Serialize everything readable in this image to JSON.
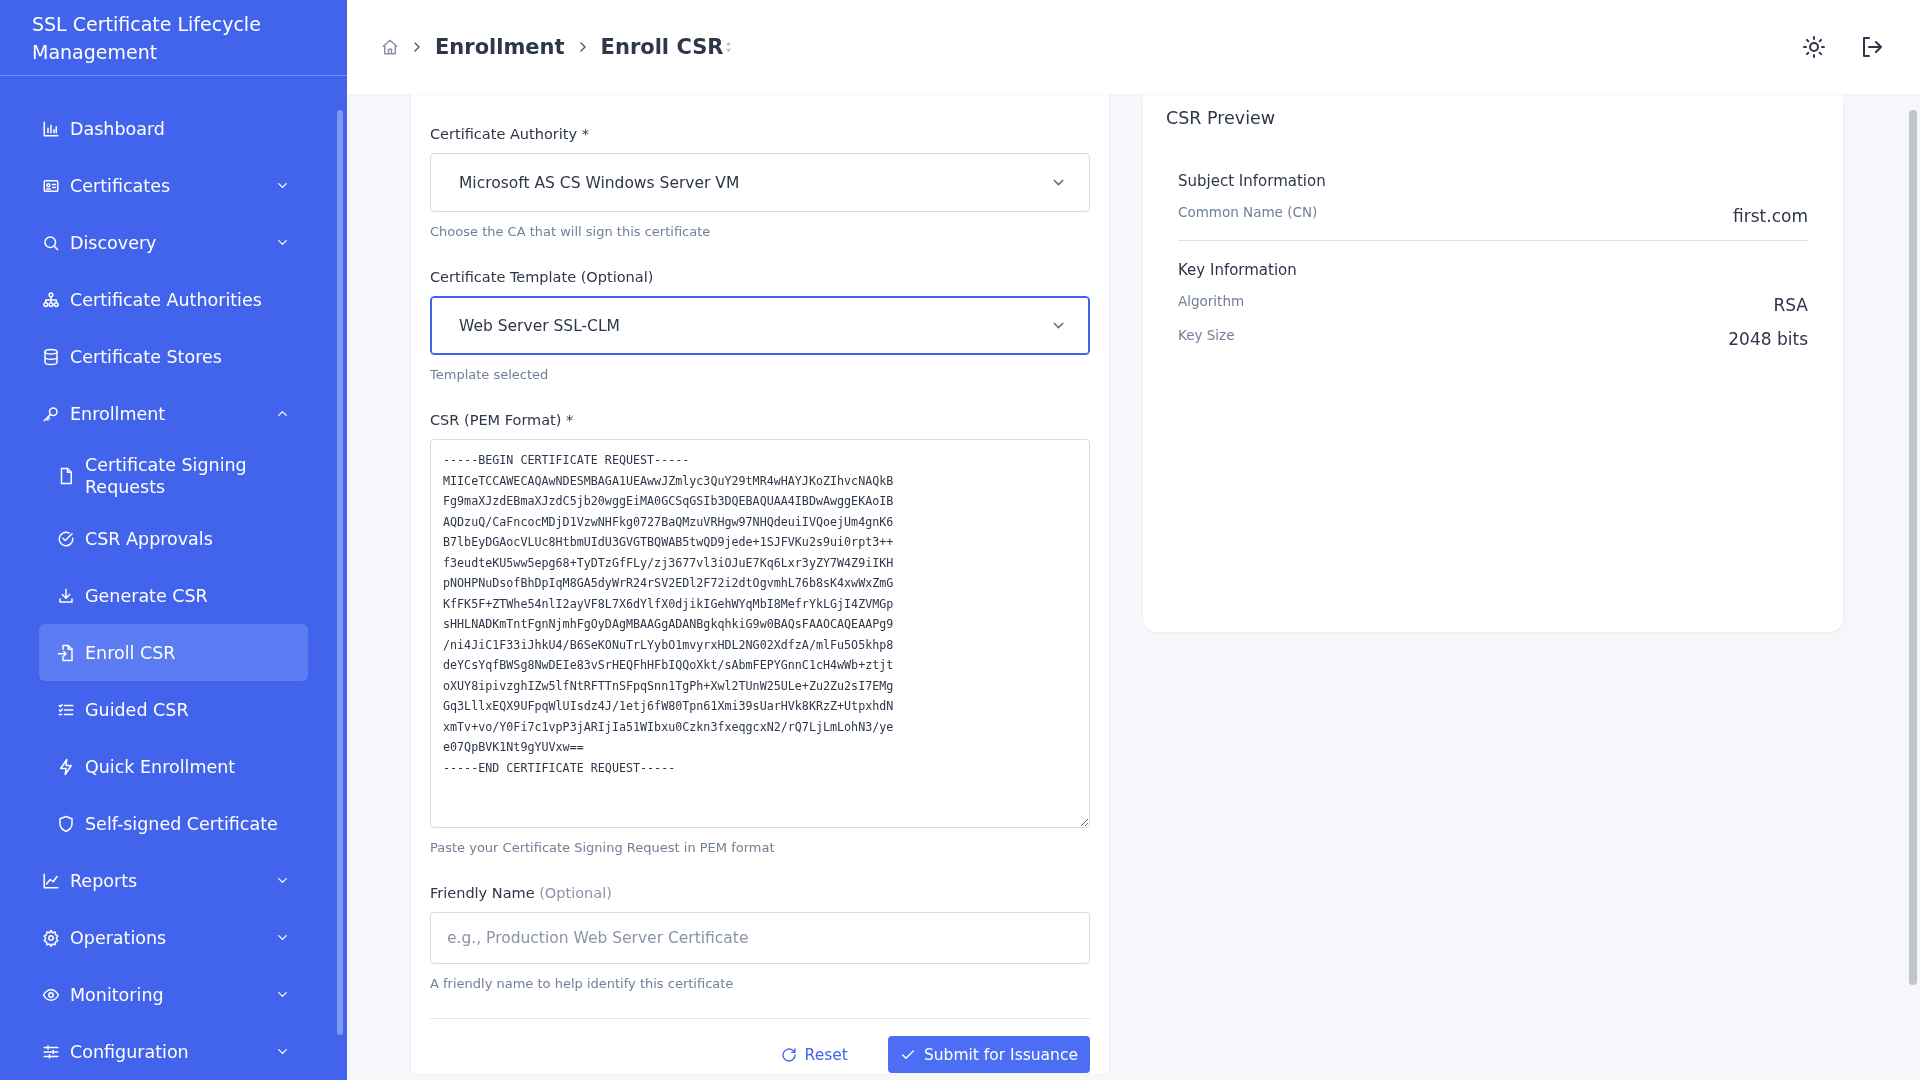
{
  "sidebar": {
    "title": "SSL Certificate Lifecycle Management",
    "items": [
      {
        "label": "Dashboard",
        "selected": false
      },
      {
        "label": "Certificates",
        "selected": false,
        "expanded": false
      },
      {
        "label": "Discovery",
        "selected": false,
        "expanded": false
      },
      {
        "label": "Certificate Authorities",
        "selected": false
      },
      {
        "label": "Certificate Stores",
        "selected": false
      },
      {
        "label": "Enrollment",
        "selected": false,
        "expanded": true,
        "children": [
          {
            "label": "Certificate Signing Requests",
            "selected": false
          },
          {
            "label": "CSR Approvals",
            "selected": false
          },
          {
            "label": "Generate CSR",
            "selected": false
          },
          {
            "label": "Enroll CSR",
            "selected": true
          },
          {
            "label": "Guided CSR",
            "selected": false
          },
          {
            "label": "Quick Enrollment",
            "selected": false
          },
          {
            "label": "Self-signed Certificate",
            "selected": false
          }
        ]
      },
      {
        "label": "Reports",
        "selected": false,
        "expanded": false
      },
      {
        "label": "Operations",
        "selected": false,
        "expanded": false
      },
      {
        "label": "Monitoring",
        "selected": false,
        "expanded": false
      },
      {
        "label": "Configuration",
        "selected": false,
        "expanded": false
      }
    ]
  },
  "breadcrumb": [
    "Enrollment",
    "Enroll CSR"
  ],
  "form": {
    "fields": [
      {
        "kind": "select",
        "label": "Certificate Authority *",
        "value": "Microsoft AS CS Windows Server VM",
        "focused": false,
        "help": "Choose the CA that will sign this certificate"
      },
      {
        "kind": "select",
        "label": "Certificate Template (Optional)",
        "value": "Web Server SSL-CLM",
        "focused": true,
        "help": "Template selected"
      },
      {
        "kind": "textarea",
        "label": "CSR (PEM Format) *",
        "value": "-----BEGIN CERTIFICATE REQUEST-----\nMIICeTCCAWECAQAwNDESMBAGA1UEAwwJZmlyc3QuY29tMR4wHAYJKoZIhvcNAQkB\nFg9maXJzdEBmaXJzdC5jb20wggEiMA0GCSqGSIb3DQEBAQUAA4IBDwAwggEKAoIB\nAQDzuQ/CaFncocMDjD1VzwNHFkg0727BaQMzuVRHgw97NHQdeuiIVQoejUm4gnK6\nB7lbEyDGAocVLUc8HtbmUIdU3GVGTBQWAB5twQD9jede+1SJFVKu2s9ui0rpt3++\nf3eudteKU5ww5epg68+TyDTzGfFLy/zj3677vl3iOJuE7Kq6Lxr3yZY7W4Z9iIKH\npNOHPNuDsofBhDpIqM8GA5dyWrR24rSV2EDl2F72i2dtOgvmhL76b8sK4xwWxZmG\nKfFK5F+ZTWhe54nlI2ayVF8L7X6dYlfX0djikIGehWYqMbI8MefrYkLGjI4ZVMGp\nsHHLNADKmTntFgnNjmhFgOyDAgMBAAGgADANBgkqhkiG9w0BAQsFAAOCAQEAAPg9\n/ni4JiC1F33iJhkU4/B6SeKONuTrLYybO1mvyrxHDL2NG02XdfzA/mlFu5O5khp8\ndeYCsYqfBWSg8NwDEIe83vSrHEQFhHFbIQQoXkt/sAbmFEPYGnnC1cH4wWb+ztjt\noXUY8ipivzghIZw5lfNtRFTTnSFpqSnn1TgPh+Xwl2TUnW25ULe+Zu2Zu2sI7EMg\nGq3LllxEQX9UFpqWlUIsdz4J/1etj6fW80Tpn61Xmi39sUarHVk8KRzZ+UtpxhdN\nxmTv+vo/Y0Fi7c1vpP3jARIjIa51WIbxu0Czkn3fxeqgcxN2/rQ7LjLmLohN3/ye\ne07QpBVK1Nt9gYUVxw==\n-----END CERTIFICATE REQUEST-----",
        "help": "Paste your Certificate Signing Request in PEM format"
      },
      {
        "kind": "input",
        "label": "Friendly Name",
        "label_note": "(Optional)",
        "placeholder": "e.g., Production Web Server Certificate",
        "help": "A friendly name to help identify this certificate"
      }
    ],
    "buttons": [
      {
        "kind": "secondary",
        "label": "Reset"
      },
      {
        "kind": "primary",
        "label": "Submit for Issuance"
      }
    ]
  },
  "preview": {
    "title": "CSR Preview",
    "sections": [
      {
        "heading": "Subject Information",
        "rows": [
          {
            "label": "Common Name (CN)",
            "value": "first.com"
          }
        ]
      },
      {
        "heading": "Key Information",
        "rows": [
          {
            "label": "Algorithm",
            "value": "RSA"
          },
          {
            "label": "Key Size",
            "value": "2048 bits"
          }
        ]
      }
    ]
  }
}
